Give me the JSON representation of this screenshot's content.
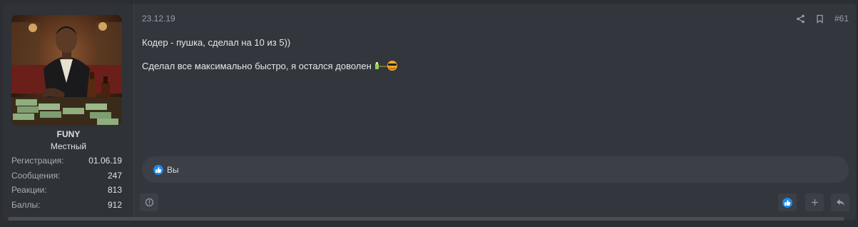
{
  "user": {
    "name": "FUNY",
    "title": "Местный",
    "stats": [
      {
        "label": "Регистрация:",
        "value": "01.06.19"
      },
      {
        "label": "Сообщения:",
        "value": "247"
      },
      {
        "label": "Реакции:",
        "value": "813"
      },
      {
        "label": "Баллы:",
        "value": "912"
      }
    ]
  },
  "post": {
    "date": "23.12.19",
    "number": "#61",
    "lines": [
      "Кодер - пушка, сделал на 10 из 5))",
      "Сделал все максимально быстро, я остался доволен"
    ]
  },
  "reactions": {
    "text": "Вы"
  },
  "icons": {
    "share": "share-icon",
    "bookmark": "bookmark-icon",
    "like": "thumbs-up-icon",
    "report": "report-icon",
    "add": "plus-icon",
    "reply": "reply-icon"
  },
  "colors": {
    "like_blue": "#1d8ae8",
    "panel": "#33363c"
  }
}
